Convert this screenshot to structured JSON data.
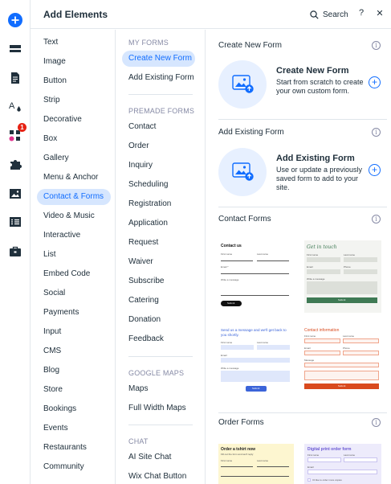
{
  "header": {
    "title": "Add Elements",
    "search_label": "Search",
    "help_label": "?",
    "close_label": "✕"
  },
  "rail": {
    "badge_count": "1",
    "icons": [
      "add-icon",
      "strip-icon",
      "page-icon",
      "theme-icon",
      "apps-icon",
      "puzzle-icon",
      "media-icon",
      "cms-icon",
      "briefcase-icon"
    ]
  },
  "categories": [
    "Text",
    "Image",
    "Button",
    "Strip",
    "Decorative",
    "Box",
    "Gallery",
    "Menu & Anchor",
    "Contact & Forms",
    "Video & Music",
    "Interactive",
    "List",
    "Embed Code",
    "Social",
    "Payments",
    "Input",
    "CMS",
    "Blog",
    "Store",
    "Bookings",
    "Events",
    "Restaurants",
    "Community"
  ],
  "active_category": "Contact & Forms",
  "subcategories": {
    "my_forms": {
      "heading": "MY FORMS",
      "items": [
        "Create New Form",
        "Add Existing Form"
      ]
    },
    "premade_forms": {
      "heading": "PREMADE FORMS",
      "items": [
        "Contact",
        "Order",
        "Inquiry",
        "Scheduling",
        "Registration",
        "Application",
        "Request",
        "Waiver",
        "Subscribe",
        "Catering",
        "Donation",
        "Feedback"
      ]
    },
    "google_maps": {
      "heading": "GOOGLE MAPS",
      "items": [
        "Maps",
        "Full Width Maps"
      ]
    },
    "chat": {
      "heading": "CHAT",
      "items": [
        "AI Site Chat",
        "Wix Chat Button"
      ]
    }
  },
  "active_subcategory": "Create New Form",
  "content": {
    "info_glyph": "i",
    "create": {
      "section_title": "Create New Form",
      "card_title": "Create New Form",
      "card_desc": "Start from scratch to create your own custom form.",
      "plus": "+"
    },
    "existing": {
      "section_title": "Add Existing Form",
      "card_title": "Add Existing Form",
      "card_desc": "Use or update a previously saved form to add to your site.",
      "plus": "+"
    },
    "contact_forms": {
      "section_title": "Contact Forms",
      "templates": [
        {
          "title": "Contact us",
          "f1": "First name",
          "f2": "Last name",
          "f3": "Email *",
          "f4": "Write a message",
          "button": "Submit"
        },
        {
          "title": "Get in touch",
          "f1": "First name",
          "f2": "Last name",
          "f3": "Email",
          "f4": "Phone",
          "f5": "Write a message",
          "button": "Submit"
        },
        {
          "title": "Send us a message and we'll get back to you shortly.",
          "f1": "First name",
          "f2": "Last name",
          "f3": "Email",
          "f4": "Write a message",
          "button": "Submit"
        },
        {
          "title": "Contact information",
          "f1": "First name",
          "f2": "Last name",
          "f3": "Email",
          "f4": "Phone",
          "f5": "Message",
          "button": "Submit"
        }
      ]
    },
    "order_forms": {
      "section_title": "Order Forms",
      "templates": [
        {
          "title": "Order a tshirt now",
          "subtitle": "Fill out the form and we'll reply",
          "f1": "First name",
          "f2": "Last name"
        },
        {
          "title": "Digital print order form",
          "f1": "First name",
          "f2": "Last name",
          "f3": "Email",
          "f4": "I'd like to order more copies"
        }
      ]
    }
  },
  "colors": {
    "accent": "#116dff",
    "active_bg": "#d6e6fe",
    "badge": "#e62214",
    "text": "#20303c",
    "muted": "#868aa5"
  }
}
